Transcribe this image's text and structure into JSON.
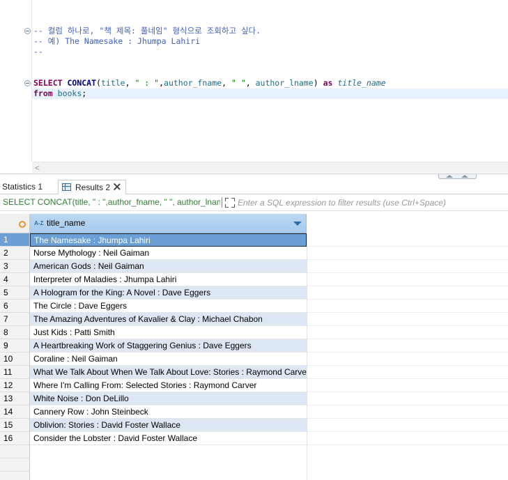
{
  "editor": {
    "comment_lines": [
      "-- 컬럼 하나로, \"책 제목: 풀네임\" 형식으로 조회하고 싶다.",
      "-- 예) The Namesake : Jhumpa Lahiri",
      "--"
    ],
    "sql": {
      "select_kw": "SELECT",
      "fn": "CONCAT",
      "open_paren": "(",
      "col1": "title",
      "comma1": ", ",
      "str1": "\" : \"",
      "comma2": ",",
      "col2": "author_fname",
      "comma3": ", ",
      "str2": "\" \"",
      "comma4": ", ",
      "col3": "author_lname",
      "close_paren": ") ",
      "as_kw": "as",
      "alias": "title_name",
      "from_kw": "from",
      "table": "books",
      "semicolon": ";"
    },
    "scroll_left_arrow": "<"
  },
  "tabs": {
    "statistics": "Statistics 1",
    "results": "Results 2"
  },
  "filter": {
    "query_text": "SELECT CONCAT(title, \" : \",author_fname, \" \", author_lnan",
    "placeholder": "Enter a SQL expression to filter results (use Ctrl+Space)"
  },
  "grid": {
    "type_badge": "A-Z",
    "column_header": "title_name",
    "selected_row": 1,
    "rows": [
      "The Namesake : Jhumpa Lahiri",
      "Norse Mythology : Neil Gaiman",
      "American Gods : Neil Gaiman",
      "Interpreter of Maladies : Jhumpa Lahiri",
      "A Hologram for the King: A Novel : Dave Eggers",
      "The Circle : Dave Eggers",
      "The Amazing Adventures of Kavalier & Clay : Michael Chabon",
      "Just Kids : Patti Smith",
      "A Heartbreaking Work of Staggering Genius : Dave Eggers",
      "Coraline : Neil Gaiman",
      "What We Talk About When We Talk About Love: Stories : Raymond Carver",
      "Where I'm Calling From: Selected Stories : Raymond Carver",
      "White Noise : Don DeLillo",
      "Cannery Row : John Steinbeck",
      "Oblivion: Stories : David Foster Wallace",
      "Consider the Lobster : David Foster Wallace"
    ],
    "row_numbers": [
      "1",
      "2",
      "3",
      "4",
      "5",
      "6",
      "7",
      "8",
      "9",
      "10",
      "11",
      "12",
      "13",
      "14",
      "15",
      "16"
    ]
  },
  "colors": {
    "selection": "#6b9fd6",
    "alt_row": "#dce7f3",
    "header": "#a6cbee",
    "keyword": "#7f0055",
    "comment": "#3f5fbf",
    "string": "#008000"
  }
}
